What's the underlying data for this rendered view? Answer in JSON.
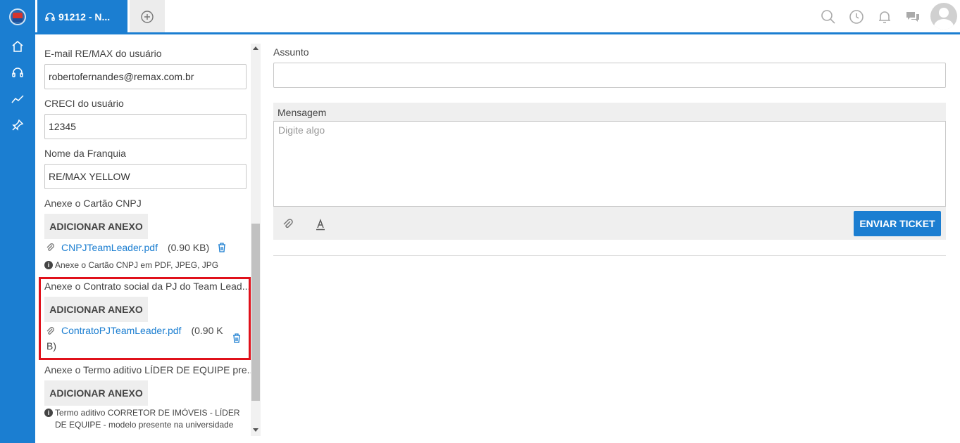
{
  "tabs": {
    "active_label": "91212 - N...",
    "add_icon": "plus-circle-icon"
  },
  "rail": {
    "items": [
      "home-icon",
      "headset-icon",
      "trend-icon",
      "pin-icon"
    ]
  },
  "topbar": {
    "icons": [
      "search-icon",
      "clock-icon",
      "bell-icon",
      "chat-icon"
    ]
  },
  "form": {
    "email_label": "E-mail RE/MAX do usuário",
    "email_value": "robertofernandes@remax.com.br",
    "creci_label": "CRECI do usuário",
    "creci_value": "12345",
    "franquia_label": "Nome da Franquia",
    "franquia_value": "RE/MAX YELLOW",
    "cnpj_label": "Anexe o Cartão CNPJ",
    "cnpj_button": "ADICIONAR ANEXO",
    "cnpj_file": "CNPJTeamLeader.pdf",
    "cnpj_size": "(0.90 KB)",
    "cnpj_hint": "Anexe o Cartão CNPJ em PDF, JPEG, JPG",
    "contrato_label": "Anexe o Contrato social da PJ do Team Lead...",
    "contrato_button": "ADICIONAR ANEXO",
    "contrato_file": "ContratoPJTeamLeader.pdf",
    "contrato_size_1": "(0.90 K",
    "contrato_size_2": "B)",
    "termo_label": "Anexe o Termo aditivo LÍDER DE EQUIPE pre...",
    "termo_button": "ADICIONAR ANEXO",
    "termo_hint": "Termo aditivo CORRETOR DE IMÓVEIS - LÍDER DE EQUIPE - modelo presente na universidade"
  },
  "ticket": {
    "assunto_label": "Assunto",
    "assunto_value": "",
    "mensagem_label": "Mensagem",
    "mensagem_placeholder": "Digite algo",
    "send_button": "ENVIAR TICKET"
  },
  "colors": {
    "brand": "#1b7ed1",
    "highlight": "#e0111b"
  }
}
